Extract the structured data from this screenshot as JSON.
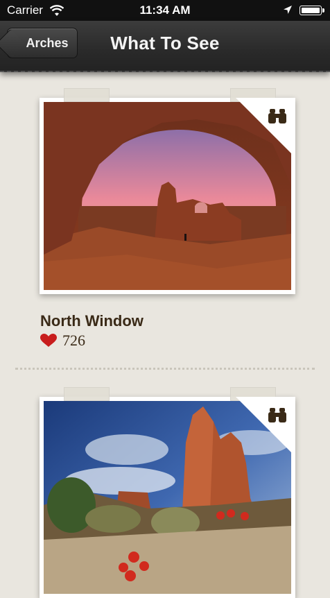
{
  "status_bar": {
    "carrier": "Carrier",
    "time": "11:34 AM"
  },
  "nav": {
    "back_label": "Arches",
    "title": "What To See"
  },
  "items": [
    {
      "title": "North Window",
      "likes": "726",
      "badge_icon": "binoculars-icon"
    },
    {
      "title": "",
      "likes": "",
      "badge_icon": "binoculars-icon"
    }
  ],
  "colors": {
    "nav_bg": "#2a2a2a",
    "page_bg": "#e9e6df",
    "title_text": "#3a2a17",
    "heart": "#c81d1d"
  }
}
